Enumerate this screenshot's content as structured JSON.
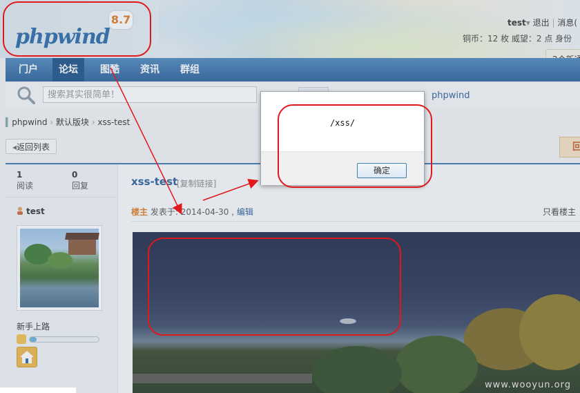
{
  "header": {
    "logo_text": "phpwind",
    "logo_version": "8.7",
    "user": {
      "name": "test",
      "logout": "退出",
      "messages": "消息(",
      "stats": "铜币：12 枚   威望：2 点   身份"
    },
    "notice": "2个新通"
  },
  "nav": {
    "items": [
      {
        "label": "门户"
      },
      {
        "label": "论坛"
      },
      {
        "label": "图酷"
      },
      {
        "label": "资讯"
      },
      {
        "label": "群组"
      }
    ]
  },
  "search": {
    "placeholder": "搜索其实很简单！",
    "site_link": "phpwind"
  },
  "breadcrumb": {
    "items": [
      "phpwind",
      "默认版块",
      "xss-test"
    ]
  },
  "toolbar": {
    "back_label": "返回列表",
    "right_btn_label": "回"
  },
  "post": {
    "views_num": "1",
    "views_label": "阅读",
    "replies_num": "0",
    "replies_label": "回复",
    "title": "xss-test",
    "copy_link": "[复制链接]",
    "author_tag": "楼主",
    "posted": "发表于: 2014-04-30 ,",
    "edit": "编辑",
    "only_host": "只看楼主"
  },
  "author": {
    "name": "test",
    "level": "新手上路",
    "level_progress": 0.1
  },
  "dialog": {
    "message": "/xss/",
    "ok_label": "确定"
  },
  "watermark": "www.wooyun.org",
  "colors": {
    "nav_bg": "#2f6aa0",
    "annotation_red": "#e0181c",
    "link_blue": "#2a5f9a",
    "host_orange": "#e07b24"
  }
}
